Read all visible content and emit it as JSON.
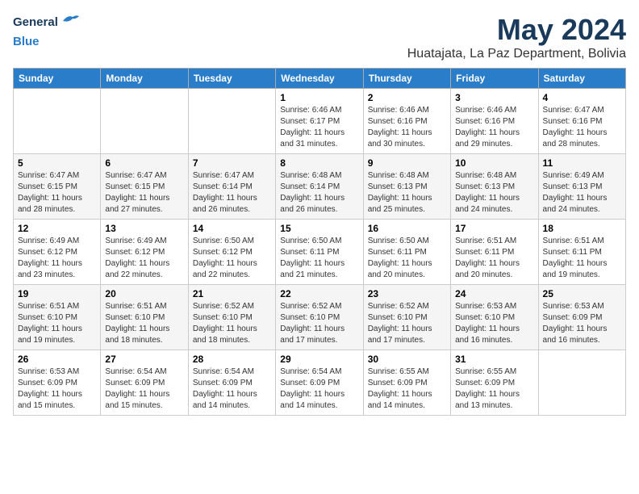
{
  "header": {
    "logo_line1": "General",
    "logo_line2": "Blue",
    "month_title": "May 2024",
    "subtitle": "Huatajata, La Paz Department, Bolivia"
  },
  "days_of_week": [
    "Sunday",
    "Monday",
    "Tuesday",
    "Wednesday",
    "Thursday",
    "Friday",
    "Saturday"
  ],
  "weeks": [
    [
      {
        "day": "",
        "info": ""
      },
      {
        "day": "",
        "info": ""
      },
      {
        "day": "",
        "info": ""
      },
      {
        "day": "1",
        "info": "Sunrise: 6:46 AM\nSunset: 6:17 PM\nDaylight: 11 hours\nand 31 minutes."
      },
      {
        "day": "2",
        "info": "Sunrise: 6:46 AM\nSunset: 6:16 PM\nDaylight: 11 hours\nand 30 minutes."
      },
      {
        "day": "3",
        "info": "Sunrise: 6:46 AM\nSunset: 6:16 PM\nDaylight: 11 hours\nand 29 minutes."
      },
      {
        "day": "4",
        "info": "Sunrise: 6:47 AM\nSunset: 6:16 PM\nDaylight: 11 hours\nand 28 minutes."
      }
    ],
    [
      {
        "day": "5",
        "info": "Sunrise: 6:47 AM\nSunset: 6:15 PM\nDaylight: 11 hours\nand 28 minutes."
      },
      {
        "day": "6",
        "info": "Sunrise: 6:47 AM\nSunset: 6:15 PM\nDaylight: 11 hours\nand 27 minutes."
      },
      {
        "day": "7",
        "info": "Sunrise: 6:47 AM\nSunset: 6:14 PM\nDaylight: 11 hours\nand 26 minutes."
      },
      {
        "day": "8",
        "info": "Sunrise: 6:48 AM\nSunset: 6:14 PM\nDaylight: 11 hours\nand 26 minutes."
      },
      {
        "day": "9",
        "info": "Sunrise: 6:48 AM\nSunset: 6:13 PM\nDaylight: 11 hours\nand 25 minutes."
      },
      {
        "day": "10",
        "info": "Sunrise: 6:48 AM\nSunset: 6:13 PM\nDaylight: 11 hours\nand 24 minutes."
      },
      {
        "day": "11",
        "info": "Sunrise: 6:49 AM\nSunset: 6:13 PM\nDaylight: 11 hours\nand 24 minutes."
      }
    ],
    [
      {
        "day": "12",
        "info": "Sunrise: 6:49 AM\nSunset: 6:12 PM\nDaylight: 11 hours\nand 23 minutes."
      },
      {
        "day": "13",
        "info": "Sunrise: 6:49 AM\nSunset: 6:12 PM\nDaylight: 11 hours\nand 22 minutes."
      },
      {
        "day": "14",
        "info": "Sunrise: 6:50 AM\nSunset: 6:12 PM\nDaylight: 11 hours\nand 22 minutes."
      },
      {
        "day": "15",
        "info": "Sunrise: 6:50 AM\nSunset: 6:11 PM\nDaylight: 11 hours\nand 21 minutes."
      },
      {
        "day": "16",
        "info": "Sunrise: 6:50 AM\nSunset: 6:11 PM\nDaylight: 11 hours\nand 20 minutes."
      },
      {
        "day": "17",
        "info": "Sunrise: 6:51 AM\nSunset: 6:11 PM\nDaylight: 11 hours\nand 20 minutes."
      },
      {
        "day": "18",
        "info": "Sunrise: 6:51 AM\nSunset: 6:11 PM\nDaylight: 11 hours\nand 19 minutes."
      }
    ],
    [
      {
        "day": "19",
        "info": "Sunrise: 6:51 AM\nSunset: 6:10 PM\nDaylight: 11 hours\nand 19 minutes."
      },
      {
        "day": "20",
        "info": "Sunrise: 6:51 AM\nSunset: 6:10 PM\nDaylight: 11 hours\nand 18 minutes."
      },
      {
        "day": "21",
        "info": "Sunrise: 6:52 AM\nSunset: 6:10 PM\nDaylight: 11 hours\nand 18 minutes."
      },
      {
        "day": "22",
        "info": "Sunrise: 6:52 AM\nSunset: 6:10 PM\nDaylight: 11 hours\nand 17 minutes."
      },
      {
        "day": "23",
        "info": "Sunrise: 6:52 AM\nSunset: 6:10 PM\nDaylight: 11 hours\nand 17 minutes."
      },
      {
        "day": "24",
        "info": "Sunrise: 6:53 AM\nSunset: 6:10 PM\nDaylight: 11 hours\nand 16 minutes."
      },
      {
        "day": "25",
        "info": "Sunrise: 6:53 AM\nSunset: 6:09 PM\nDaylight: 11 hours\nand 16 minutes."
      }
    ],
    [
      {
        "day": "26",
        "info": "Sunrise: 6:53 AM\nSunset: 6:09 PM\nDaylight: 11 hours\nand 15 minutes."
      },
      {
        "day": "27",
        "info": "Sunrise: 6:54 AM\nSunset: 6:09 PM\nDaylight: 11 hours\nand 15 minutes."
      },
      {
        "day": "28",
        "info": "Sunrise: 6:54 AM\nSunset: 6:09 PM\nDaylight: 11 hours\nand 14 minutes."
      },
      {
        "day": "29",
        "info": "Sunrise: 6:54 AM\nSunset: 6:09 PM\nDaylight: 11 hours\nand 14 minutes."
      },
      {
        "day": "30",
        "info": "Sunrise: 6:55 AM\nSunset: 6:09 PM\nDaylight: 11 hours\nand 14 minutes."
      },
      {
        "day": "31",
        "info": "Sunrise: 6:55 AM\nSunset: 6:09 PM\nDaylight: 11 hours\nand 13 minutes."
      },
      {
        "day": "",
        "info": ""
      }
    ]
  ]
}
